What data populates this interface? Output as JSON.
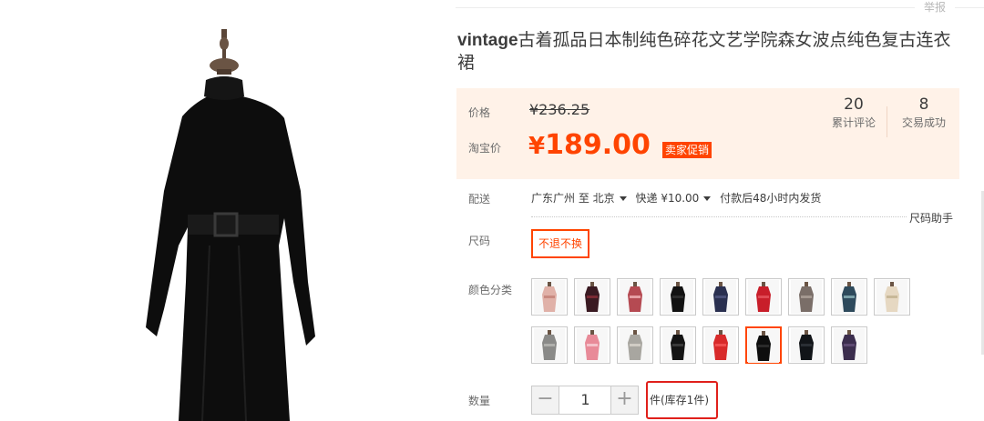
{
  "header": {
    "report_label": "举报"
  },
  "product": {
    "title_en": "vintage",
    "title_cn": "古着孤品日本制纯色碎花文艺学院森女波点纯色复古连衣裙",
    "main_image_icon": "black-dress-on-mannequin-image"
  },
  "price": {
    "price_label": "价格",
    "original_price": "¥236.25",
    "taobao_price_label": "淘宝价",
    "promo_currency": "¥",
    "promo_price": "189.00",
    "promo_badge": "卖家促销",
    "reviews_count": "20",
    "reviews_label": "累计评论",
    "sales_count": "8",
    "sales_label": "交易成功"
  },
  "shipping": {
    "label": "配送",
    "from": "广东广州 至",
    "to": "北京",
    "method": "快递 ¥10.00",
    "dispatch": "付款后48小时内发货"
  },
  "size": {
    "label": "尺码",
    "helper_label": "尺码助手",
    "selected_option": "不退不换"
  },
  "colors": {
    "label": "颜色分类",
    "swatches": [
      {
        "name": "pink-floral-dress",
        "color": "#e0b1a8",
        "accent": "#c98a80"
      },
      {
        "name": "black-burgundy-dress",
        "color": "#3a1a22",
        "accent": "#7a2a34"
      },
      {
        "name": "red-floral-dress",
        "color": "#b54a52",
        "accent": "#e6a0a4"
      },
      {
        "name": "black-dress-1",
        "color": "#121212",
        "accent": "#2c2c2c"
      },
      {
        "name": "navy-dress",
        "color": "#2a3050",
        "accent": "#4a5078"
      },
      {
        "name": "red-dress-1",
        "color": "#c81e2a",
        "accent": "#e04a54"
      },
      {
        "name": "grey-pattern-dress",
        "color": "#7a6e68",
        "accent": "#a49890"
      },
      {
        "name": "blue-green-dress",
        "color": "#2e4a5c",
        "accent": "#7aa0a8"
      },
      {
        "name": "cream-dress",
        "color": "#e6d8c2",
        "accent": "#c8b898"
      },
      {
        "name": "grey-coat-dress",
        "color": "#8a8a88",
        "accent": "#b0b0ac"
      },
      {
        "name": "pink-lace-dress",
        "color": "#e88a98",
        "accent": "#f4c2ca"
      },
      {
        "name": "grey-cardigan-dress",
        "color": "#a8a6a0",
        "accent": "#d0ccc4"
      },
      {
        "name": "black-dress-2",
        "color": "#141414",
        "accent": "#3a3a3a"
      },
      {
        "name": "red-dress-2",
        "color": "#d82a2a",
        "accent": "#f05050"
      },
      {
        "name": "black-dress-selected",
        "color": "#0e0e0e",
        "accent": "#2a2a2a",
        "selected": true
      },
      {
        "name": "black-dress-3",
        "color": "#111418",
        "accent": "#2a2e34"
      },
      {
        "name": "purple-dress",
        "color": "#3c2e4e",
        "accent": "#5e4a72"
      }
    ]
  },
  "quantity": {
    "label": "数量",
    "minus": "−",
    "plus": "+",
    "value": "1",
    "stock_text": "件(库存1件)"
  }
}
